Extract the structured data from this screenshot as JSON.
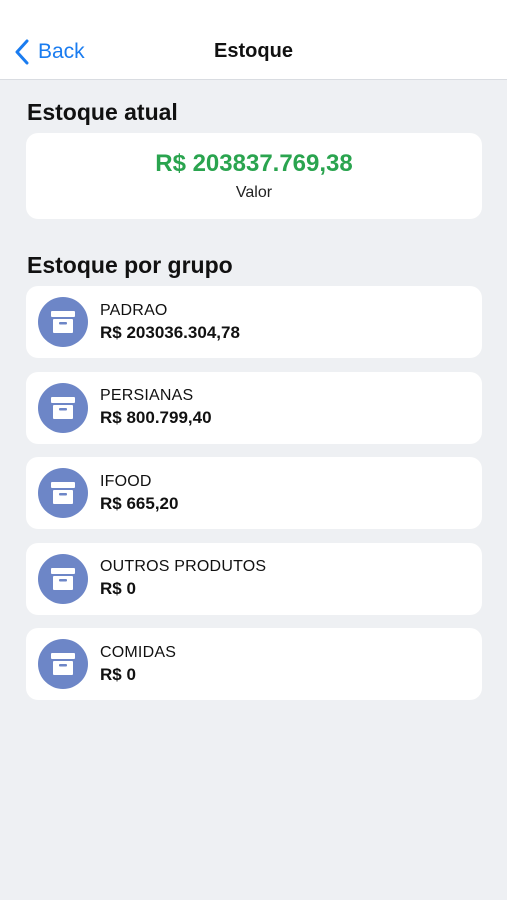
{
  "nav": {
    "back_label": "Back",
    "title": "Estoque"
  },
  "current_stock": {
    "section_title": "Estoque atual",
    "value": "R$ 203837.769,38",
    "caption": "Valor"
  },
  "groups": {
    "section_title": "Estoque por grupo",
    "items": [
      {
        "name": "PADRAO",
        "value": "R$ 203036.304,78",
        "icon": "archive-box-icon"
      },
      {
        "name": "PERSIANAS",
        "value": "R$ 800.799,40",
        "icon": "archive-box-icon"
      },
      {
        "name": "IFOOD",
        "value": "R$ 665,20",
        "icon": "archive-box-icon"
      },
      {
        "name": "OUTROS PRODUTOS",
        "value": "R$ 0",
        "icon": "archive-box-icon"
      },
      {
        "name": "COMIDAS",
        "value": "R$ 0",
        "icon": "archive-box-icon"
      }
    ]
  },
  "colors": {
    "accent_blue": "#1a7cf0",
    "value_green": "#2aa44f",
    "icon_circle": "#6d86c7",
    "background": "#eef0f3"
  }
}
